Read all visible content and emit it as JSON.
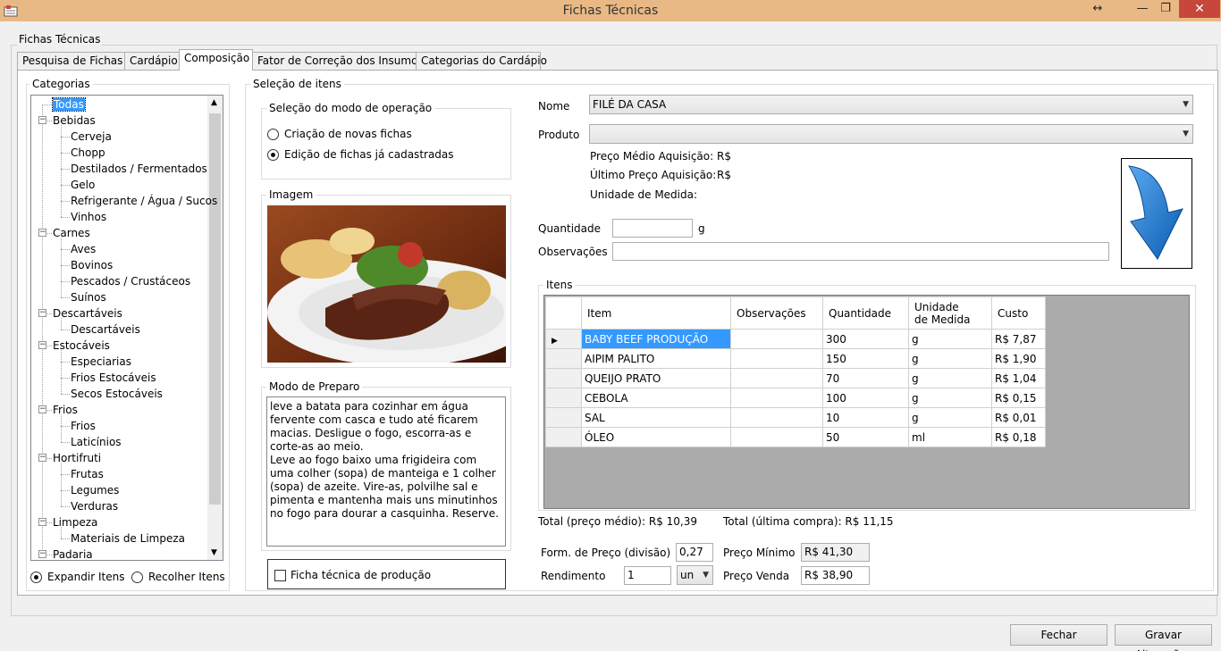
{
  "window": {
    "title": "Fichas Técnicas",
    "resize_glyph": "↔",
    "max_glyph": "❐",
    "min_glyph": "—",
    "close_glyph": "✕"
  },
  "form_group_label": "Fichas Técnicas",
  "tabs": [
    "Pesquisa de Fichas",
    "Cardápio",
    "Composição",
    "Fator de Correção dos Insumos",
    "Categorias do Cardápio"
  ],
  "active_tab": "Composição",
  "categories": {
    "label": "Categorias",
    "tree": [
      {
        "label": "Todas",
        "level": 0,
        "selected": true
      },
      {
        "label": "Bebidas",
        "level": 0,
        "expand": "−"
      },
      {
        "label": "Cerveja",
        "level": 1
      },
      {
        "label": "Chopp",
        "level": 1
      },
      {
        "label": "Destilados / Fermentados",
        "level": 1
      },
      {
        "label": "Gelo",
        "level": 1
      },
      {
        "label": "Refrigerante / Água / Sucos",
        "level": 1
      },
      {
        "label": "Vinhos",
        "level": 1
      },
      {
        "label": "Carnes",
        "level": 0,
        "expand": "−"
      },
      {
        "label": "Aves",
        "level": 1
      },
      {
        "label": "Bovinos",
        "level": 1
      },
      {
        "label": "Pescados / Crustáceos",
        "level": 1
      },
      {
        "label": "Suínos",
        "level": 1
      },
      {
        "label": "Descartáveis",
        "level": 0,
        "expand": "−"
      },
      {
        "label": "Descartáveis",
        "level": 1
      },
      {
        "label": "Estocáveis",
        "level": 0,
        "expand": "−"
      },
      {
        "label": "Especiarias",
        "level": 1
      },
      {
        "label": "Frios Estocáveis",
        "level": 1
      },
      {
        "label": "Secos Estocáveis",
        "level": 1
      },
      {
        "label": "Frios",
        "level": 0,
        "expand": "−"
      },
      {
        "label": "Frios",
        "level": 1
      },
      {
        "label": "Laticínios",
        "level": 1
      },
      {
        "label": "Hortifruti",
        "level": 0,
        "expand": "−"
      },
      {
        "label": "Frutas",
        "level": 1
      },
      {
        "label": "Legumes",
        "level": 1
      },
      {
        "label": "Verduras",
        "level": 1
      },
      {
        "label": "Limpeza",
        "level": 0,
        "expand": "−"
      },
      {
        "label": "Materiais de Limpeza",
        "level": 1
      },
      {
        "label": "Padaria",
        "level": 0,
        "expand": "−"
      }
    ],
    "expand_label": "Expandir Itens",
    "collapse_label": "Recolher Itens"
  },
  "selection": {
    "label": "Seleção de itens",
    "mode_label": "Seleção do modo de operação",
    "mode_new": "Criação de novas fichas",
    "mode_edit": "Edição de fichas já cadastradas",
    "image_label": "Imagem",
    "prep_label": "Modo de Preparo",
    "prep_text": "leve a batata para cozinhar em água fervente com casca e tudo até ficarem macias. Desligue o fogo, escorra-as e corte-as ao meio.\nLeve ao fogo baixo uma frigideira com uma colher (sopa) de manteiga e 1 colher (sopa) de azeite. Vire-as, polvilhe sal e pimenta e mantenha mais uns minutinhos no fogo para dourar a casquinha. Reserve.",
    "production_label": "Ficha técnica de produção"
  },
  "detail": {
    "nome_label": "Nome",
    "nome_value": "FILÉ DA CASA",
    "produto_label": "Produto",
    "produto_value": "",
    "preco_medio_label": "Preço Médio Aquisição:",
    "preco_medio_value": "R$",
    "ultimo_preco_label": "Último Preço Aquisição:",
    "ultimo_preco_value": "R$",
    "unidade_label": "Unidade de Medida:",
    "quantidade_label": "Quantidade",
    "quantidade_value": "",
    "quantidade_unit": "g",
    "obs_label": "Observações",
    "obs_value": ""
  },
  "items": {
    "label": "Itens",
    "columns": [
      "Item",
      "Observações",
      "Quantidade",
      "Unidade\nde Medida",
      "Custo"
    ],
    "current_row_glyph": "▶",
    "rows": [
      [
        "BABY BEEF PRODUÇÃO",
        "",
        "300",
        "g",
        "R$ 7,87"
      ],
      [
        "AIPIM PALITO",
        "",
        "150",
        "g",
        "R$ 1,90"
      ],
      [
        "QUEIJO PRATO",
        "",
        "70",
        "g",
        "R$ 1,04"
      ],
      [
        "CEBOLA",
        "",
        "100",
        "g",
        "R$ 0,15"
      ],
      [
        "SAL",
        "",
        "10",
        "g",
        "R$ 0,01"
      ],
      [
        "ÓLEO",
        "",
        "50",
        "ml",
        "R$ 0,18"
      ]
    ]
  },
  "totals": {
    "medio": "Total (preço médio): R$ 10,39",
    "ultima": "Total (última compra): R$ 11,15",
    "form_preco_label": "Form. de Preço (divisão)",
    "form_preco_value": "0,27",
    "preco_minimo_label": "Preço Mínimo",
    "preco_minimo_value": "R$ 41,30",
    "rendimento_label": "Rendimento",
    "rendimento_value": "1",
    "rendimento_unit": "un",
    "preco_venda_label": "Preço Venda",
    "preco_venda_value": "R$ 38,90"
  },
  "buttons": {
    "close": "Fechar",
    "save": "Gravar Alterações"
  },
  "colors": {
    "titlebar": "#e9b985",
    "close": "#c7473a",
    "selection": "#3399ff",
    "arrow": "#1a73c8"
  }
}
